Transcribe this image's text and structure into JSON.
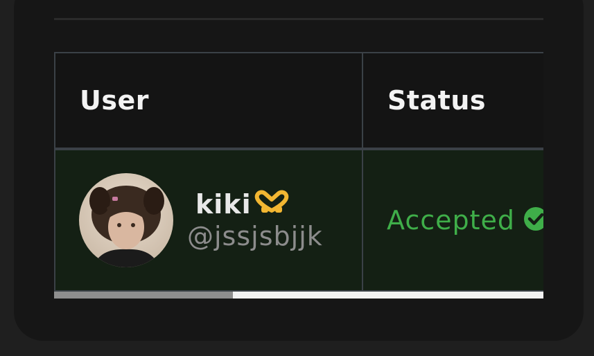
{
  "table": {
    "columns": [
      "User",
      "Status"
    ],
    "rows": [
      {
        "display_name": "kiki",
        "display_name_emoji": "heart-hands-emoji",
        "handle": "@jssjsbjjk",
        "status": "Accepted",
        "status_icon": "check-circle-icon"
      }
    ]
  },
  "scrollbar": {
    "position_fraction": 0.365
  },
  "colors": {
    "status_accepted": "#3fae49",
    "row_highlight": "#142014",
    "header_bg": "#141414",
    "border": "#3b4147"
  }
}
